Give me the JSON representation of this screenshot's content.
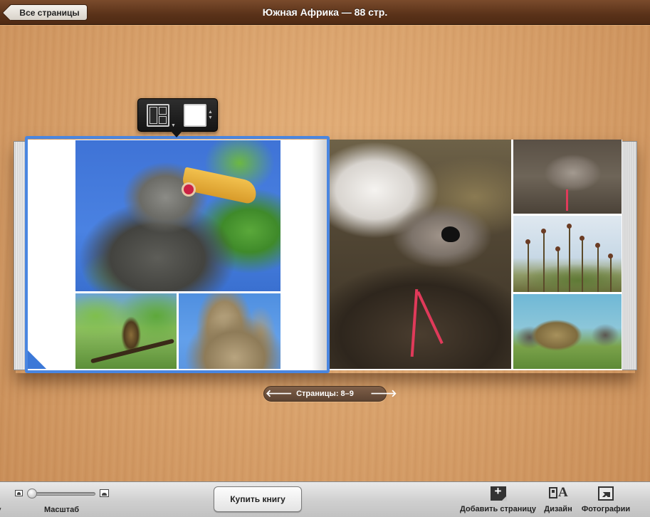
{
  "window": {
    "title": "Южная Африка — 88 стр.",
    "back_button": "Все страницы"
  },
  "book": {
    "left_page": {
      "selected": true,
      "photos": [
        "hornbill-closeup",
        "hornbill-on-branch",
        "termite-mound"
      ]
    },
    "right_page": {
      "photos": [
        "lapwing-wings-spread",
        "lapwing-walking",
        "wildflowers",
        "elephants-at-water-tank"
      ]
    }
  },
  "popover": {
    "layout_icon": "layout-grid-icon",
    "background_icon": "white-background-swatch"
  },
  "pager": {
    "label": "Страницы: 8–9",
    "prev_icon": "arrow-left-icon",
    "next_icon": "arrow-right-icon"
  },
  "toolbar": {
    "cut_label": "у",
    "zoom": {
      "label": "Масштаб",
      "value": 0.05
    },
    "buy_button": "Купить книгу",
    "add_page": "Добавить страницу",
    "design": "Дизайн",
    "photos": "Фотографии"
  },
  "colors": {
    "selection": "#4a86e0",
    "titlebar": "#5a3219"
  }
}
